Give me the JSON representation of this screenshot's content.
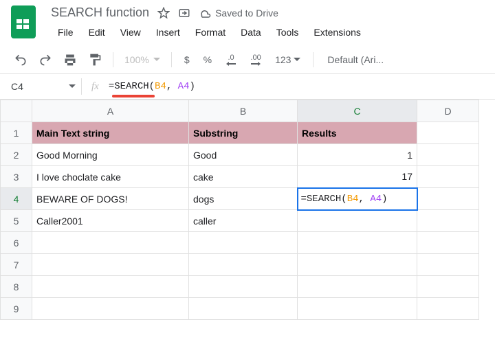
{
  "doc": {
    "title": "SEARCH function",
    "saved_label": "Saved to Drive"
  },
  "menu": {
    "file": "File",
    "edit": "Edit",
    "view": "View",
    "insert": "Insert",
    "format": "Format",
    "data": "Data",
    "tools": "Tools",
    "extensions": "Extensions"
  },
  "toolbar": {
    "zoom": "100%",
    "currency": "$",
    "percent": "%",
    "dec_dec": ".0",
    "inc_dec": ".00",
    "num_format": "123",
    "font": "Default (Ari..."
  },
  "formula_bar": {
    "cell_ref": "C4",
    "fx": "fx",
    "prefix": "=SEARCH(",
    "ref1": "B4",
    "comma": ", ",
    "ref2": "A4",
    "suffix": ")"
  },
  "columns": {
    "a": "A",
    "b": "B",
    "c": "C",
    "d": "D"
  },
  "rows": [
    "1",
    "2",
    "3",
    "4",
    "5",
    "6",
    "7",
    "8",
    "9"
  ],
  "headers": {
    "a": "Main Text string",
    "b": "Substring",
    "c": "Results"
  },
  "data": {
    "r2": {
      "a": "Good Morning",
      "b": "Good",
      "c": "1"
    },
    "r3": {
      "a": "I love choclate cake",
      "b": "cake",
      "c": "17"
    },
    "r4": {
      "a": "BEWARE OF DOGS!",
      "b": "dogs",
      "c_prefix": "=SEARCH(",
      "c_ref1": "B4",
      "c_comma": ", ",
      "c_ref2": "A4",
      "c_suffix": ")"
    },
    "r5": {
      "a": "Caller2001",
      "b": "caller",
      "c": ""
    }
  }
}
